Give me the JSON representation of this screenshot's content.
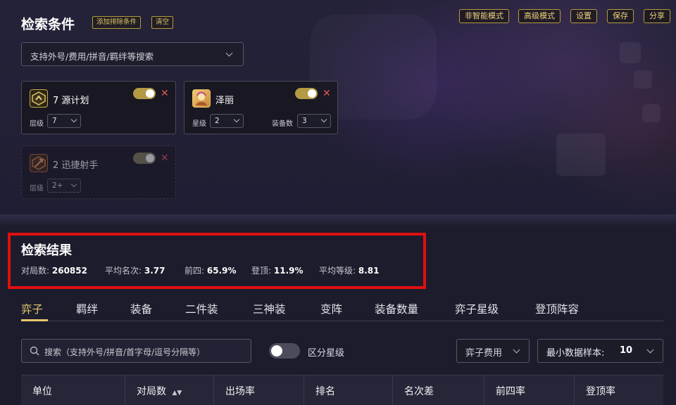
{
  "search_conditions": {
    "title": "检索条件",
    "add_exclude_label": "添加排除条件",
    "clear_label": "清空",
    "search_placeholder": "支持外号/费用/拼音/羁绊等搜索"
  },
  "mode_buttons": {
    "non_smart": "非智能模式",
    "advanced": "高级模式",
    "settings": "设置",
    "save": "保存",
    "share": "分享"
  },
  "condition_cards": [
    {
      "name": "7 源计划",
      "icon": "trait-icon",
      "toggle_on": true,
      "field1_label": "层级",
      "field1_value": "7"
    },
    {
      "name": "泽丽",
      "icon": "champion-portrait",
      "toggle_on": true,
      "field1_label": "星级",
      "field1_value": "2",
      "field2_label": "装备数",
      "field2_value": "3"
    },
    {
      "name": "2 迅捷射手",
      "icon": "trait-icon",
      "toggle_on": true,
      "disabled": true,
      "field1_label": "层级",
      "field1_value": "2+"
    }
  ],
  "results": {
    "title": "检索结果",
    "stats": [
      {
        "label": "对局数:",
        "value": "260852"
      },
      {
        "label": "平均名次:",
        "value": "3.77"
      },
      {
        "label": "前四:",
        "value": "65.9%"
      },
      {
        "label": "登顶:",
        "value": "11.9%"
      },
      {
        "label": "平均等级:",
        "value": "8.81"
      }
    ]
  },
  "tabs": [
    "弈子",
    "羁绊",
    "装备",
    "二件装",
    "三神装",
    "变阵",
    "装备数量",
    "弈子星级",
    "登顶阵容"
  ],
  "filters": {
    "search_placeholder": "搜索（支持外号/拼音/首字母/逗号分隔等）",
    "star_toggle_label": "区分星级",
    "cost_select": "弈子费用",
    "min_sample_label": "最小数据样本:",
    "min_sample_value": "10"
  },
  "table_headers": [
    "单位",
    "对局数",
    "出场率",
    "排名",
    "名次差",
    "前四率",
    "登顶率"
  ],
  "colors": {
    "accent_gold": "#e6c76b",
    "highlight_red": "#e01010",
    "close_red": "#e05555"
  }
}
